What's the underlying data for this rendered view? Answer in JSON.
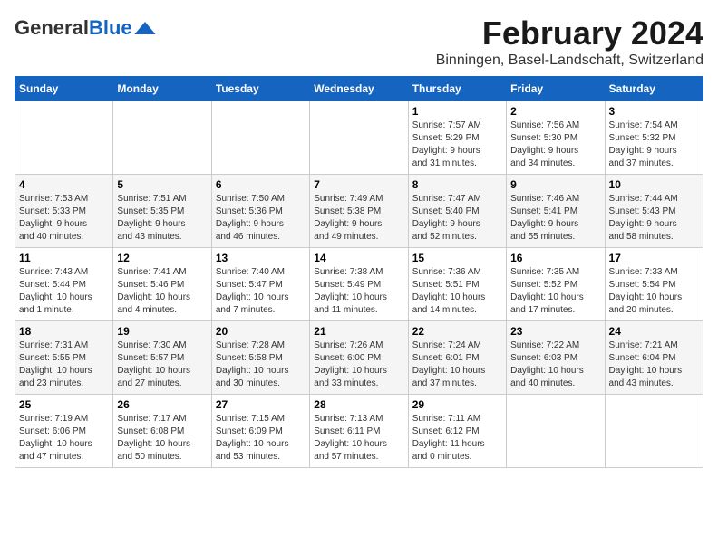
{
  "logo": {
    "general": "General",
    "blue": "Blue"
  },
  "title": "February 2024",
  "subtitle": "Binningen, Basel-Landschaft, Switzerland",
  "headers": [
    "Sunday",
    "Monday",
    "Tuesday",
    "Wednesday",
    "Thursday",
    "Friday",
    "Saturday"
  ],
  "weeks": [
    [
      {
        "day": "",
        "info": ""
      },
      {
        "day": "",
        "info": ""
      },
      {
        "day": "",
        "info": ""
      },
      {
        "day": "",
        "info": ""
      },
      {
        "day": "1",
        "info": "Sunrise: 7:57 AM\nSunset: 5:29 PM\nDaylight: 9 hours\nand 31 minutes."
      },
      {
        "day": "2",
        "info": "Sunrise: 7:56 AM\nSunset: 5:30 PM\nDaylight: 9 hours\nand 34 minutes."
      },
      {
        "day": "3",
        "info": "Sunrise: 7:54 AM\nSunset: 5:32 PM\nDaylight: 9 hours\nand 37 minutes."
      }
    ],
    [
      {
        "day": "4",
        "info": "Sunrise: 7:53 AM\nSunset: 5:33 PM\nDaylight: 9 hours\nand 40 minutes."
      },
      {
        "day": "5",
        "info": "Sunrise: 7:51 AM\nSunset: 5:35 PM\nDaylight: 9 hours\nand 43 minutes."
      },
      {
        "day": "6",
        "info": "Sunrise: 7:50 AM\nSunset: 5:36 PM\nDaylight: 9 hours\nand 46 minutes."
      },
      {
        "day": "7",
        "info": "Sunrise: 7:49 AM\nSunset: 5:38 PM\nDaylight: 9 hours\nand 49 minutes."
      },
      {
        "day": "8",
        "info": "Sunrise: 7:47 AM\nSunset: 5:40 PM\nDaylight: 9 hours\nand 52 minutes."
      },
      {
        "day": "9",
        "info": "Sunrise: 7:46 AM\nSunset: 5:41 PM\nDaylight: 9 hours\nand 55 minutes."
      },
      {
        "day": "10",
        "info": "Sunrise: 7:44 AM\nSunset: 5:43 PM\nDaylight: 9 hours\nand 58 minutes."
      }
    ],
    [
      {
        "day": "11",
        "info": "Sunrise: 7:43 AM\nSunset: 5:44 PM\nDaylight: 10 hours\nand 1 minute."
      },
      {
        "day": "12",
        "info": "Sunrise: 7:41 AM\nSunset: 5:46 PM\nDaylight: 10 hours\nand 4 minutes."
      },
      {
        "day": "13",
        "info": "Sunrise: 7:40 AM\nSunset: 5:47 PM\nDaylight: 10 hours\nand 7 minutes."
      },
      {
        "day": "14",
        "info": "Sunrise: 7:38 AM\nSunset: 5:49 PM\nDaylight: 10 hours\nand 11 minutes."
      },
      {
        "day": "15",
        "info": "Sunrise: 7:36 AM\nSunset: 5:51 PM\nDaylight: 10 hours\nand 14 minutes."
      },
      {
        "day": "16",
        "info": "Sunrise: 7:35 AM\nSunset: 5:52 PM\nDaylight: 10 hours\nand 17 minutes."
      },
      {
        "day": "17",
        "info": "Sunrise: 7:33 AM\nSunset: 5:54 PM\nDaylight: 10 hours\nand 20 minutes."
      }
    ],
    [
      {
        "day": "18",
        "info": "Sunrise: 7:31 AM\nSunset: 5:55 PM\nDaylight: 10 hours\nand 23 minutes."
      },
      {
        "day": "19",
        "info": "Sunrise: 7:30 AM\nSunset: 5:57 PM\nDaylight: 10 hours\nand 27 minutes."
      },
      {
        "day": "20",
        "info": "Sunrise: 7:28 AM\nSunset: 5:58 PM\nDaylight: 10 hours\nand 30 minutes."
      },
      {
        "day": "21",
        "info": "Sunrise: 7:26 AM\nSunset: 6:00 PM\nDaylight: 10 hours\nand 33 minutes."
      },
      {
        "day": "22",
        "info": "Sunrise: 7:24 AM\nSunset: 6:01 PM\nDaylight: 10 hours\nand 37 minutes."
      },
      {
        "day": "23",
        "info": "Sunrise: 7:22 AM\nSunset: 6:03 PM\nDaylight: 10 hours\nand 40 minutes."
      },
      {
        "day": "24",
        "info": "Sunrise: 7:21 AM\nSunset: 6:04 PM\nDaylight: 10 hours\nand 43 minutes."
      }
    ],
    [
      {
        "day": "25",
        "info": "Sunrise: 7:19 AM\nSunset: 6:06 PM\nDaylight: 10 hours\nand 47 minutes."
      },
      {
        "day": "26",
        "info": "Sunrise: 7:17 AM\nSunset: 6:08 PM\nDaylight: 10 hours\nand 50 minutes."
      },
      {
        "day": "27",
        "info": "Sunrise: 7:15 AM\nSunset: 6:09 PM\nDaylight: 10 hours\nand 53 minutes."
      },
      {
        "day": "28",
        "info": "Sunrise: 7:13 AM\nSunset: 6:11 PM\nDaylight: 10 hours\nand 57 minutes."
      },
      {
        "day": "29",
        "info": "Sunrise: 7:11 AM\nSunset: 6:12 PM\nDaylight: 11 hours\nand 0 minutes."
      },
      {
        "day": "",
        "info": ""
      },
      {
        "day": "",
        "info": ""
      }
    ]
  ]
}
